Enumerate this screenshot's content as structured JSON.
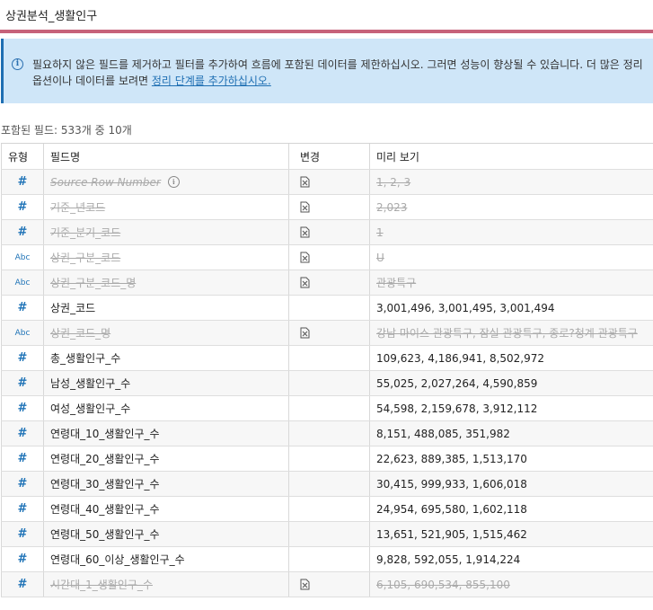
{
  "title": "상권분석_생활인구",
  "info": {
    "text": "필요하지 않은 필드를 제거하고 필터를 추가하여 흐름에 포함된 데이터를 제한하십시오. 그러면 성능이 향상될 수 있습니다. 더 많은 정리 옵션이나 데이터를 보려면 ",
    "link": "정리 단계를 추가하십시오."
  },
  "count_label": "포함된 필드: 533개 중 10개",
  "columns": {
    "type": "유형",
    "name": "필드명",
    "change": "변경",
    "preview": "미리 보기"
  },
  "rows": [
    {
      "type": "#",
      "name": "Source Row Number",
      "preview": "1, 2, 3",
      "removed": true,
      "info": true
    },
    {
      "type": "#",
      "name": "기준_년코드",
      "preview": "2,023",
      "removed": true
    },
    {
      "type": "#",
      "name": "기준_분기_코드",
      "preview": "1",
      "removed": true
    },
    {
      "type": "Abc",
      "name": "상권_구분_코드",
      "preview": "U",
      "removed": true
    },
    {
      "type": "Abc",
      "name": "상권_구분_코드_명",
      "preview": "관광특구",
      "removed": true
    },
    {
      "type": "#",
      "name": "상권_코드",
      "preview": "3,001,496, 3,001,495, 3,001,494",
      "removed": false
    },
    {
      "type": "Abc",
      "name": "상권_코드_명",
      "preview": "강남 마이스 관광특구, 잠실 관광특구, 종로?청계 관광특구",
      "removed": true
    },
    {
      "type": "#",
      "name": "총_생활인구_수",
      "preview": "109,623, 4,186,941, 8,502,972",
      "removed": false
    },
    {
      "type": "#",
      "name": "남성_생활인구_수",
      "preview": "55,025, 2,027,264, 4,590,859",
      "removed": false
    },
    {
      "type": "#",
      "name": "여성_생활인구_수",
      "preview": "54,598, 2,159,678, 3,912,112",
      "removed": false
    },
    {
      "type": "#",
      "name": "연령대_10_생활인구_수",
      "preview": "8,151, 488,085, 351,982",
      "removed": false
    },
    {
      "type": "#",
      "name": "연령대_20_생활인구_수",
      "preview": "22,623, 889,385, 1,513,170",
      "removed": false
    },
    {
      "type": "#",
      "name": "연령대_30_생활인구_수",
      "preview": "30,415, 999,933, 1,606,018",
      "removed": false
    },
    {
      "type": "#",
      "name": "연령대_40_생활인구_수",
      "preview": "24,954, 695,580, 1,602,118",
      "removed": false
    },
    {
      "type": "#",
      "name": "연령대_50_생활인구_수",
      "preview": "13,651, 521,905, 1,515,462",
      "removed": false
    },
    {
      "type": "#",
      "name": "연령대_60_이상_생활인구_수",
      "preview": "9,828, 592,055, 1,914,224",
      "removed": false
    },
    {
      "type": "#",
      "name": "시간대_1_생활인구_수",
      "preview": "6,105, 690,534, 855,100",
      "removed": true
    }
  ],
  "colors": {
    "accent": "#c6627a",
    "info_bg": "#cfe6f8",
    "type_blue": "#1f73b7"
  },
  "icons": {
    "info": "info-icon",
    "removed": "removed-field-icon"
  }
}
